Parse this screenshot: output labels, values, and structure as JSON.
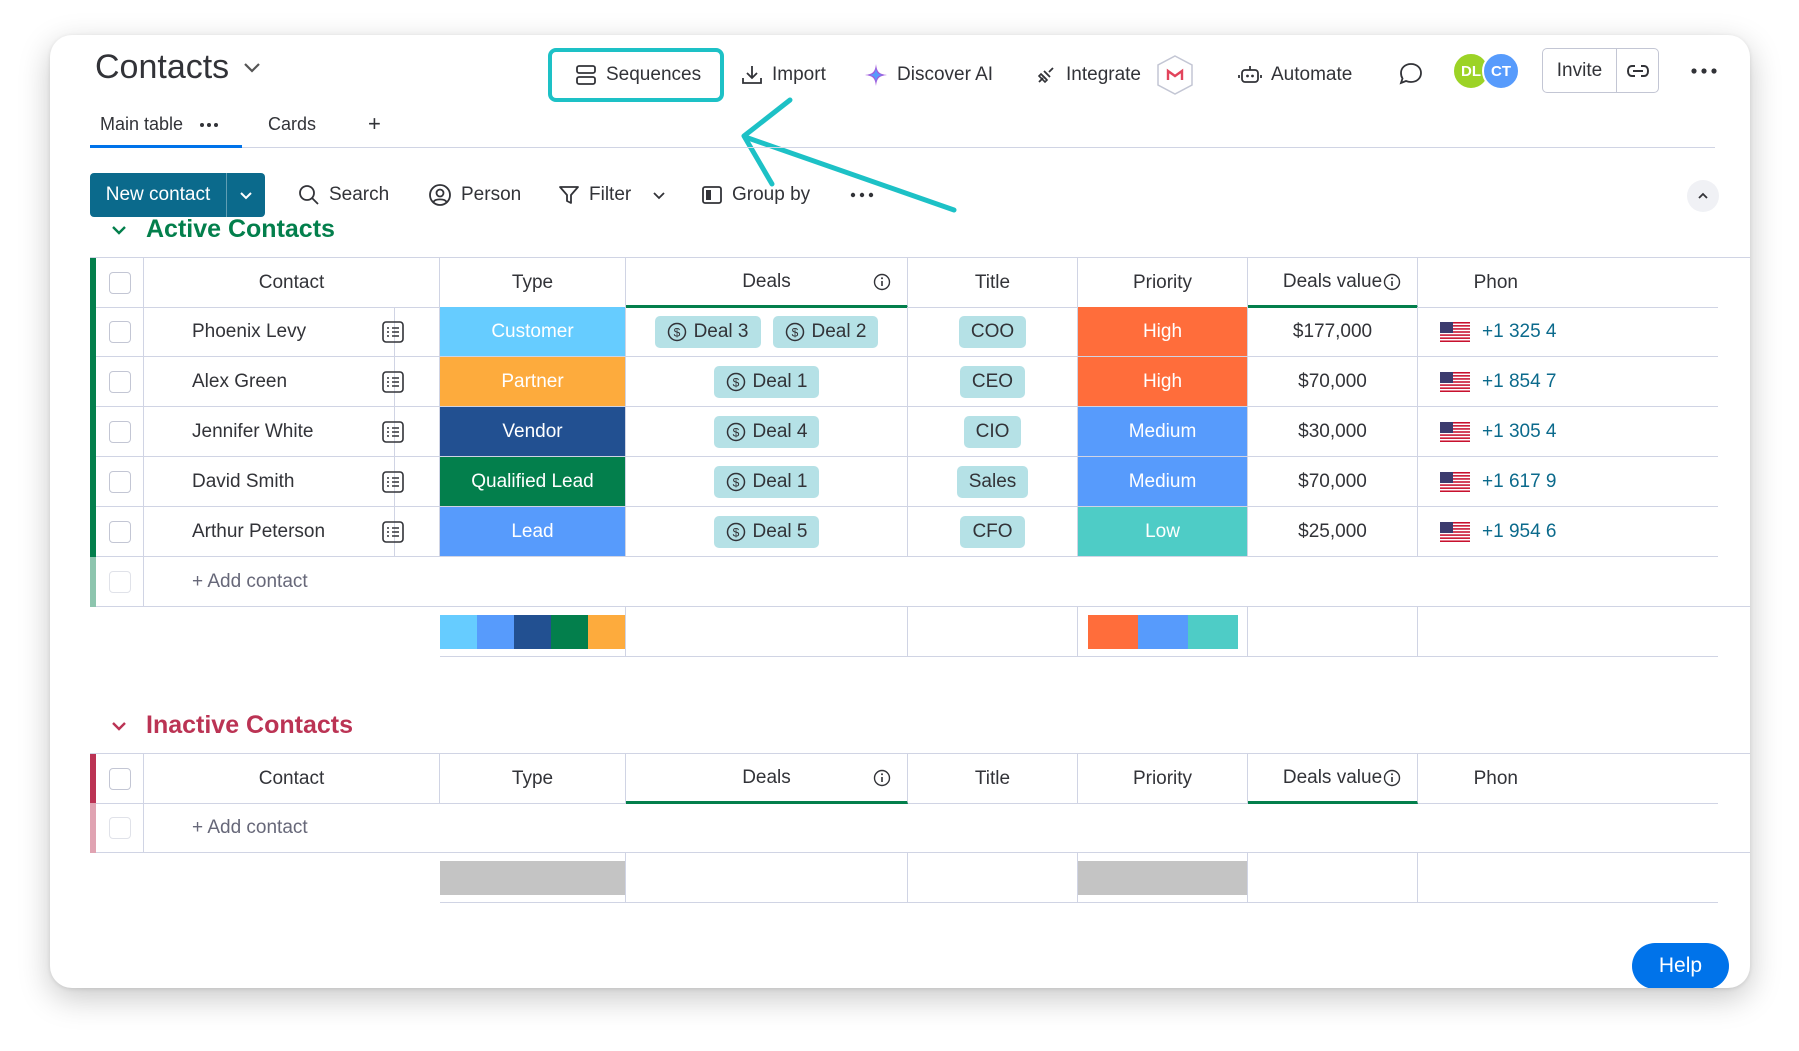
{
  "board": {
    "title": "Contacts"
  },
  "header": {
    "sequences": "Sequences",
    "import": "Import",
    "discover_ai": "Discover AI",
    "integrate": "Integrate",
    "automate": "Automate",
    "invite": "Invite",
    "avatars": [
      {
        "initials": "DL",
        "color": "#9cd326"
      },
      {
        "initials": "CT",
        "color": "#579bfc"
      }
    ]
  },
  "views": {
    "tabs": [
      "Main table",
      "Cards"
    ],
    "add": "+"
  },
  "toolbar": {
    "new_contact": "New contact",
    "search": "Search",
    "person": "Person",
    "filter": "Filter",
    "group_by": "Group by"
  },
  "columns": [
    "Contact",
    "Type",
    "Deals",
    "Title",
    "Priority",
    "Deals value",
    "Phon"
  ],
  "groups": [
    {
      "title": "Active Contacts",
      "color": "#037f4c",
      "rows": [
        {
          "contact": "Phoenix Levy",
          "type": "Customer",
          "type_color": "#66ccff",
          "deals": [
            "Deal 3",
            "Deal 2"
          ],
          "title": "COO",
          "priority": "High",
          "priority_color": "#ff6d3b",
          "value": "$177,000",
          "phone": "+1 325 4"
        },
        {
          "contact": "Alex Green",
          "type": "Partner",
          "type_color": "#fdab3d",
          "deals": [
            "Deal 1"
          ],
          "title": "CEO",
          "priority": "High",
          "priority_color": "#ff6d3b",
          "value": "$70,000",
          "phone": "+1 854 7"
        },
        {
          "contact": "Jennifer White",
          "type": "Vendor",
          "type_color": "#225091",
          "deals": [
            "Deal 4"
          ],
          "title": "CIO",
          "priority": "Medium",
          "priority_color": "#579bfc",
          "value": "$30,000",
          "phone": "+1 305 4"
        },
        {
          "contact": "David Smith",
          "type": "Qualified Lead",
          "type_color": "#037f4c",
          "deals": [
            "Deal 1"
          ],
          "title": "Sales",
          "priority": "Medium",
          "priority_color": "#579bfc",
          "value": "$70,000",
          "phone": "+1 617 9"
        },
        {
          "contact": "Arthur Peterson",
          "type": "Lead",
          "type_color": "#579bfc",
          "deals": [
            "Deal 5"
          ],
          "title": "CFO",
          "priority": "Low",
          "priority_color": "#4eccc6",
          "value": "$25,000",
          "phone": "+1 954 6"
        }
      ],
      "add_label": "+ Add contact",
      "type_summary_colors": [
        "#66ccff",
        "#579bfc",
        "#225091",
        "#037f4c",
        "#fdab3d"
      ],
      "priority_summary_colors": [
        "#ff6d3b",
        "#579bfc",
        "#4eccc6"
      ]
    },
    {
      "title": "Inactive Contacts",
      "color": "#bb3354",
      "rows": [],
      "add_label": "+ Add contact",
      "type_summary_colors": [
        "#c4c4c4"
      ],
      "priority_summary_colors": [
        "#c4c4c4"
      ]
    }
  ],
  "help": "Help"
}
